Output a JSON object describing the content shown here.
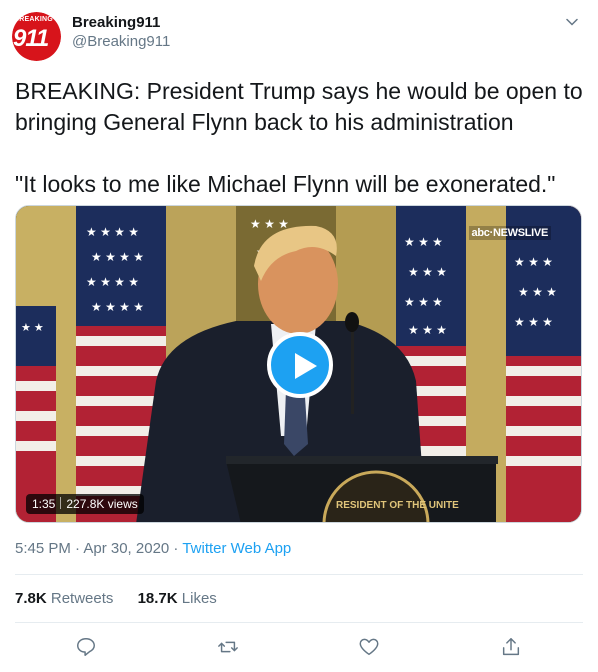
{
  "account": {
    "display_name": "Breaking911",
    "handle": "@Breaking911",
    "avatar_small_text": "BREAKING",
    "avatar_big_text": "911"
  },
  "tweet": {
    "line1": "BREAKING: President Trump says he would be open to bringing General Flynn back to his administration",
    "line2": "\"It looks to me like Michael Flynn will be exonerated.\""
  },
  "media": {
    "network_logo": "NEWSLIVE",
    "network_prefix": "abc",
    "duration": "1:35",
    "views": "227.8K views",
    "seal_text": "RESIDENT OF THE UNITE"
  },
  "meta": {
    "time": "5:45 PM · Apr 30, 2020",
    "separator": " · ",
    "app": "Twitter Web App"
  },
  "stats": {
    "retweets_count": "7.8K",
    "retweets_label": "Retweets",
    "likes_count": "18.7K",
    "likes_label": "Likes"
  },
  "colors": {
    "accent": "#1da1f2",
    "avatar_red": "#d7141b",
    "muted": "#657786"
  },
  "icons": [
    "chevron-down-icon",
    "reply-icon",
    "retweet-icon",
    "like-icon",
    "share-icon",
    "play-icon"
  ]
}
